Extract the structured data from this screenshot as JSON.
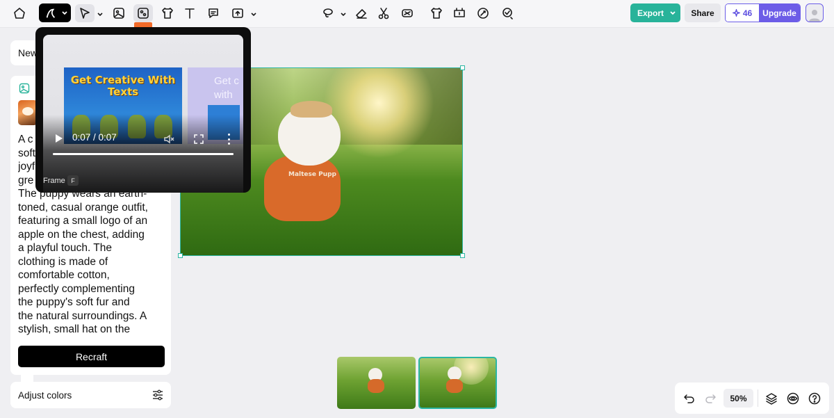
{
  "toolbar": {
    "export_label": "Export",
    "share_label": "Share",
    "credits": "46",
    "upgrade_label": "Upgrade"
  },
  "tooltip": {
    "time": "0:07 / 0:07",
    "progress_fraction": 1.0,
    "label": "Frame",
    "shortcut": "F",
    "slide_main_title": "Get Creative With Texts",
    "slide_next_title": "Get c with"
  },
  "panel": {
    "new_label": "New",
    "prompt_text": "A c... soft... joyf... gre... The puppy wears an earth-toned, casual orange outfit, featuring a small logo of an apple on the chest, adding a playful touch. The clothing is made of comfortable cotton, perfectly complementing the puppy's soft fur and the natural surroundings. A stylish, small hat on the",
    "prompt_lines": [
      "A c",
      "soft",
      "joyf",
      "gre",
      "The puppy wears an earth-",
      "toned, casual orange outfit,",
      "featuring a small logo of an",
      "apple on the chest, adding",
      "a playful touch. The",
      "clothing is made of",
      "comfortable cotton,",
      "perfectly complementing",
      "the puppy's soft fur and",
      "the natural surroundings. A",
      "stylish, small hat on the"
    ],
    "recraft_label": "Recraft",
    "adjust_label": "Adjust colors"
  },
  "canvas": {
    "outfit_text": "Maltese Pupp"
  },
  "zoom": {
    "value": "50%"
  },
  "colors": {
    "accent": "#28b39a",
    "upgrade": "#6c5ce7",
    "selection": "#2bb6a3"
  }
}
